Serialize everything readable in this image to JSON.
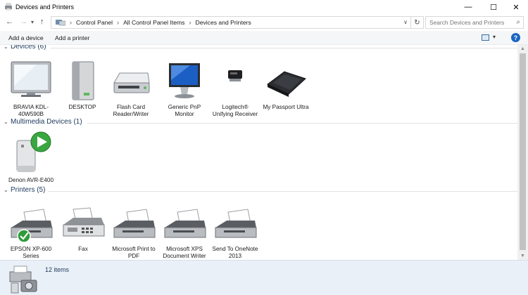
{
  "window": {
    "title": "Devices and Printers"
  },
  "nav": {
    "breadcrumbs": [
      "Control Panel",
      "All Control Panel Items",
      "Devices and Printers"
    ]
  },
  "search": {
    "placeholder": "Search Devices and Printers"
  },
  "toolbar": {
    "add_device": "Add a device",
    "add_printer": "Add a printer"
  },
  "groups": {
    "devices": {
      "label": "Devices (6)",
      "items": [
        {
          "label": "BRAVIA KDL-40W590B",
          "icon": "tv-icon"
        },
        {
          "label": "DESKTOP",
          "icon": "computer-tower-icon"
        },
        {
          "label": "Flash Card Reader/Writer",
          "icon": "card-reader-icon"
        },
        {
          "label": "Generic PnP Monitor",
          "icon": "monitor-icon"
        },
        {
          "label": "Logitech® Unifying Receiver",
          "icon": "usb-receiver-icon"
        },
        {
          "label": "My Passport Ultra",
          "icon": "external-drive-icon"
        }
      ]
    },
    "multimedia": {
      "label": "Multimedia Devices (1)",
      "items": [
        {
          "label": "Denon AVR-E400",
          "icon": "media-device-icon"
        }
      ]
    },
    "printers": {
      "label": "Printers (5)",
      "items": [
        {
          "label": "EPSON XP-600 Series",
          "icon": "printer-icon",
          "default": true
        },
        {
          "label": "Fax",
          "icon": "fax-icon"
        },
        {
          "label": "Microsoft Print to PDF",
          "icon": "printer-icon"
        },
        {
          "label": "Microsoft XPS Document Writer",
          "icon": "printer-icon"
        },
        {
          "label": "Send To OneNote 2013",
          "icon": "printer-icon"
        }
      ]
    }
  },
  "status": {
    "count": "12 items"
  },
  "colors": {
    "group_header": "#1e395b",
    "status_bg": "#e9f0f7",
    "accent": "#1a66c2"
  }
}
